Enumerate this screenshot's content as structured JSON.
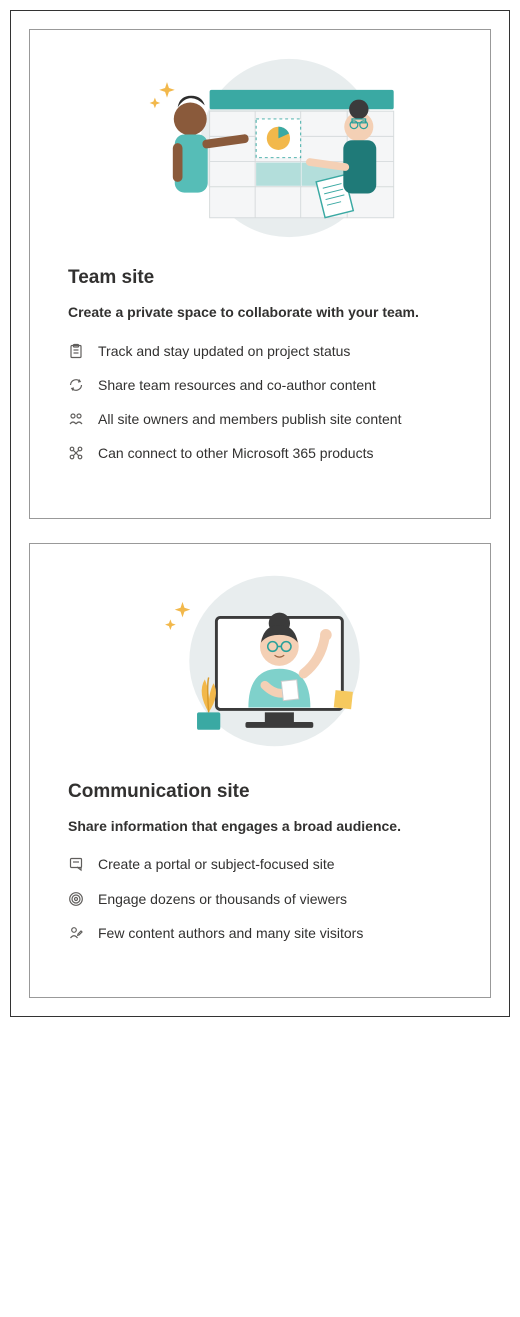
{
  "cards": [
    {
      "title": "Team site",
      "subtitle": "Create a private space to collaborate with your team.",
      "features": [
        {
          "icon": "clipboard-icon",
          "text": "Track and stay updated on project status"
        },
        {
          "icon": "sync-icon",
          "text": "Share team resources and co-author content"
        },
        {
          "icon": "people-icon",
          "text": "All site owners and members publish site content"
        },
        {
          "icon": "connect-icon",
          "text": "Can connect to other Microsoft 365 products"
        }
      ]
    },
    {
      "title": "Communication site",
      "subtitle": "Share information that engages a broad audience.",
      "features": [
        {
          "icon": "note-icon",
          "text": "Create a portal or subject-focused site"
        },
        {
          "icon": "broadcast-icon",
          "text": "Engage dozens or thousands of viewers"
        },
        {
          "icon": "author-icon",
          "text": "Few content authors and many site visitors"
        }
      ]
    }
  ]
}
